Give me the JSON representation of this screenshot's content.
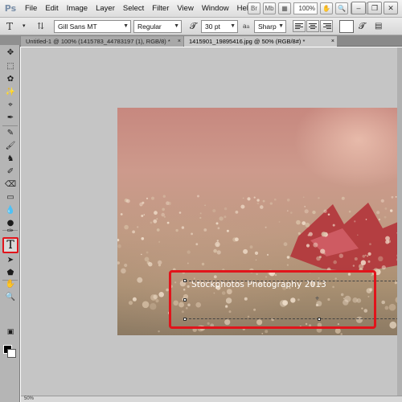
{
  "app": {
    "logo": "Ps"
  },
  "menu": [
    "File",
    "Edit",
    "Image",
    "Layer",
    "Select",
    "Filter",
    "View",
    "Window",
    "Help"
  ],
  "menu_right": {
    "zoom": "100%"
  },
  "window_controls": [
    "minimize",
    "restore",
    "close"
  ],
  "options": {
    "tool_icon": "T",
    "font_family": "Gill Sans MT",
    "font_style": "Regular",
    "font_size": "30 pt",
    "aa_label": "a",
    "antialias": "Sharp"
  },
  "tabs": [
    {
      "label": "Untitled-1 @ 100% (1415783_44783197 (1), RGB/8) *",
      "active": false
    },
    {
      "label": "1415901_19895416.jpg @ 50% (RGB/8#) *",
      "active": true
    }
  ],
  "canvas": {
    "text_layer": "Stockphotos Photography 2013"
  },
  "status": {
    "zoom": "50%"
  },
  "colors": {
    "highlight": "#e1141b",
    "foreground": "#000000",
    "background": "#ffffff",
    "workspace": "#c5c5c5"
  },
  "tools": [
    "move-icon",
    "marquee-icon",
    "lasso-icon",
    "quick-select-icon",
    "crop-icon",
    "eyedropper-icon",
    "healing-icon",
    "brush-icon",
    "stamp-icon",
    "history-brush-icon",
    "eraser-icon",
    "gradient-icon",
    "blur-icon",
    "dodge-icon",
    "pen-icon",
    "type-icon",
    "path-select-icon",
    "shape-icon",
    "hand-icon",
    "zoom-icon"
  ]
}
